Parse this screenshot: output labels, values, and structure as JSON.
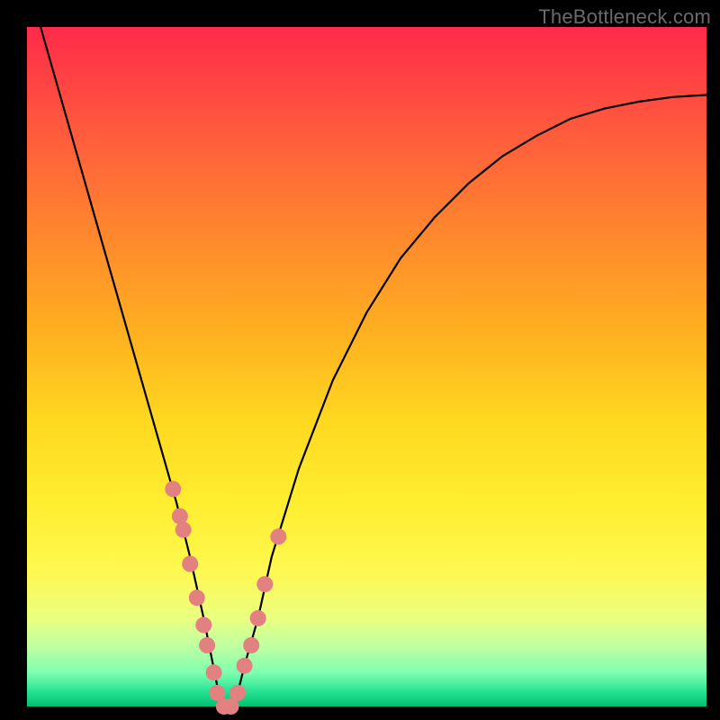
{
  "watermark": "TheBottleneck.com",
  "chart_data": {
    "type": "line",
    "title": "",
    "xlabel": "",
    "ylabel": "",
    "ylim": [
      0,
      100
    ],
    "xlim": [
      0,
      100
    ],
    "series": [
      {
        "name": "bottleneck-curve",
        "x": [
          2,
          4,
          6,
          8,
          10,
          12,
          14,
          16,
          18,
          20,
          22,
          24,
          26,
          27,
          28,
          29,
          30,
          31,
          32,
          34,
          36,
          40,
          45,
          50,
          55,
          60,
          65,
          70,
          75,
          80,
          85,
          90,
          95,
          100
        ],
        "values": [
          100,
          93,
          86,
          79,
          72,
          65,
          58,
          51,
          44,
          37,
          30,
          22,
          13,
          8,
          3,
          0,
          0,
          2,
          6,
          13,
          22,
          35,
          48,
          58,
          66,
          72,
          77,
          81,
          84,
          86.5,
          88,
          89,
          89.7,
          90
        ]
      }
    ],
    "markers": {
      "name": "highlighted-points",
      "x": [
        21.5,
        22.5,
        23,
        24,
        25,
        26,
        26.5,
        27.5,
        28,
        29,
        30,
        31,
        32,
        33,
        34,
        35,
        37
      ],
      "values": [
        32,
        28,
        26,
        21,
        16,
        12,
        9,
        5,
        2,
        0,
        0,
        2,
        6,
        9,
        13,
        18,
        25
      ]
    },
    "gradient_stops": [
      {
        "pos": 0,
        "color": "#ff2a4a"
      },
      {
        "pos": 12,
        "color": "#ff5040"
      },
      {
        "pos": 28,
        "color": "#ff8030"
      },
      {
        "pos": 45,
        "color": "#ffb020"
      },
      {
        "pos": 58,
        "color": "#ffd820"
      },
      {
        "pos": 70,
        "color": "#ffee30"
      },
      {
        "pos": 80,
        "color": "#fff850"
      },
      {
        "pos": 87,
        "color": "#eaff80"
      },
      {
        "pos": 91,
        "color": "#c0ffa0"
      },
      {
        "pos": 95,
        "color": "#80ffb0"
      },
      {
        "pos": 98,
        "color": "#20e090"
      },
      {
        "pos": 100,
        "color": "#00c070"
      }
    ]
  }
}
